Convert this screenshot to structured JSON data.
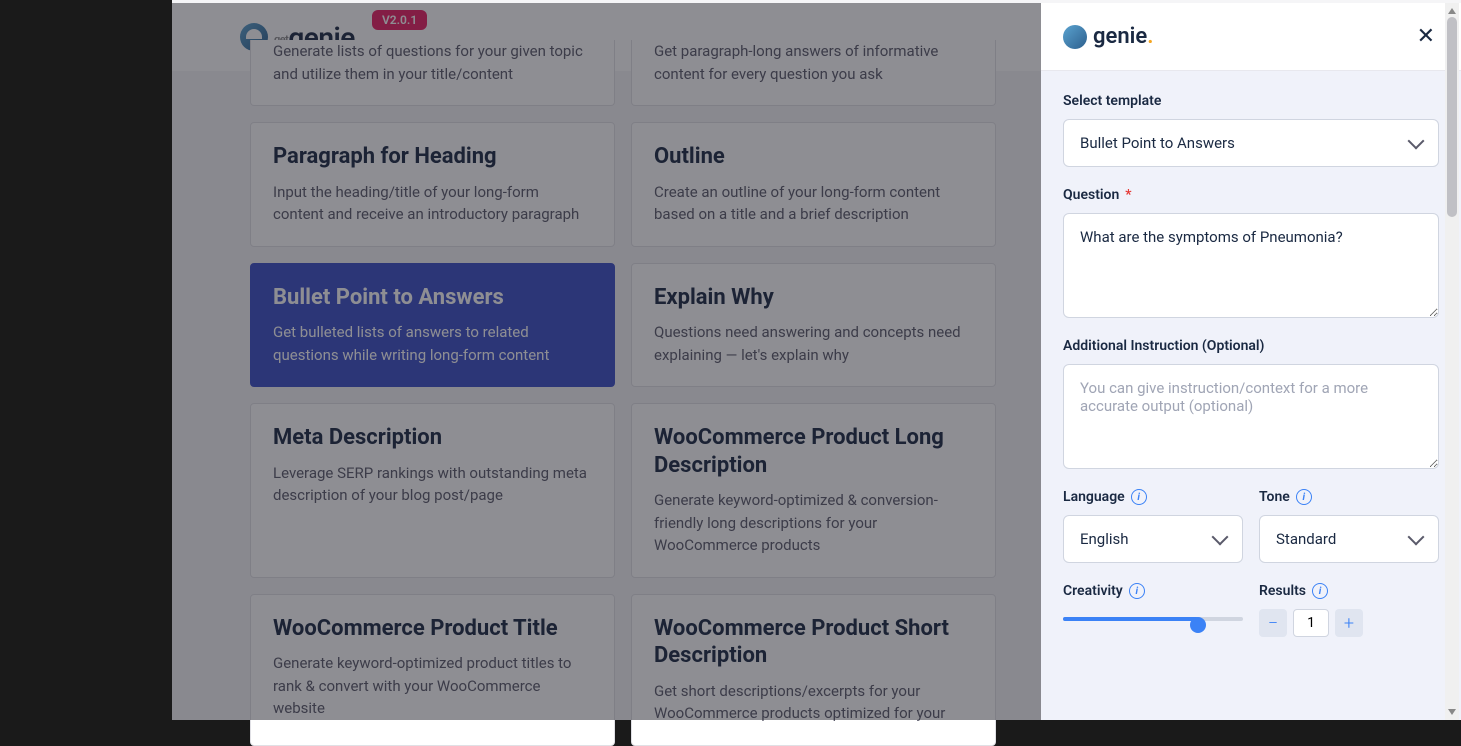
{
  "brand": {
    "name_prefix": "get",
    "name": "genie",
    "version": "V2.0.1"
  },
  "cards": [
    {
      "title": "",
      "desc": "Generate lists of questions for your given topic and utilize them in your title/content"
    },
    {
      "title": "",
      "desc": "Get paragraph-long answers of informative content for every question you ask"
    },
    {
      "title": "Paragraph for Heading",
      "desc": "Input the heading/title of your long-form content and receive an introductory paragraph"
    },
    {
      "title": "Outline",
      "desc": "Create an outline of your long-form content based on a title and a brief description"
    },
    {
      "title": "Bullet Point to Answers",
      "desc": "Get bulleted lists of answers to related questions while writing long-form content",
      "selected": true
    },
    {
      "title": "Explain Why",
      "desc": "Questions need answering and concepts need explaining — let's explain why"
    },
    {
      "title": "Meta Description",
      "desc": "Leverage SERP rankings with outstanding meta description of your blog post/page"
    },
    {
      "title": "WooCommerce Product Long Description",
      "desc": "Generate keyword-optimized & conversion-friendly long descriptions for your WooCommerce products"
    },
    {
      "title": "WooCommerce Product Title",
      "desc": "Generate keyword-optimized product titles to rank & convert with your WooCommerce website"
    },
    {
      "title": "WooCommerce Product Short Description",
      "desc": "Get short descriptions/excerpts for your WooCommerce products optimized for your"
    }
  ],
  "panel": {
    "template_label": "Select template",
    "template_value": "Bullet Point to Answers",
    "question_label": "Question",
    "question_value": "What are the symptoms of Pneumonia?",
    "additional_label": "Additional Instruction (Optional)",
    "additional_placeholder": "You can give instruction/context for a more accurate output (optional)",
    "language_label": "Language",
    "language_value": "English",
    "tone_label": "Tone",
    "tone_value": "Standard",
    "creativity_label": "Creativity",
    "results_label": "Results",
    "results_value": "1"
  }
}
